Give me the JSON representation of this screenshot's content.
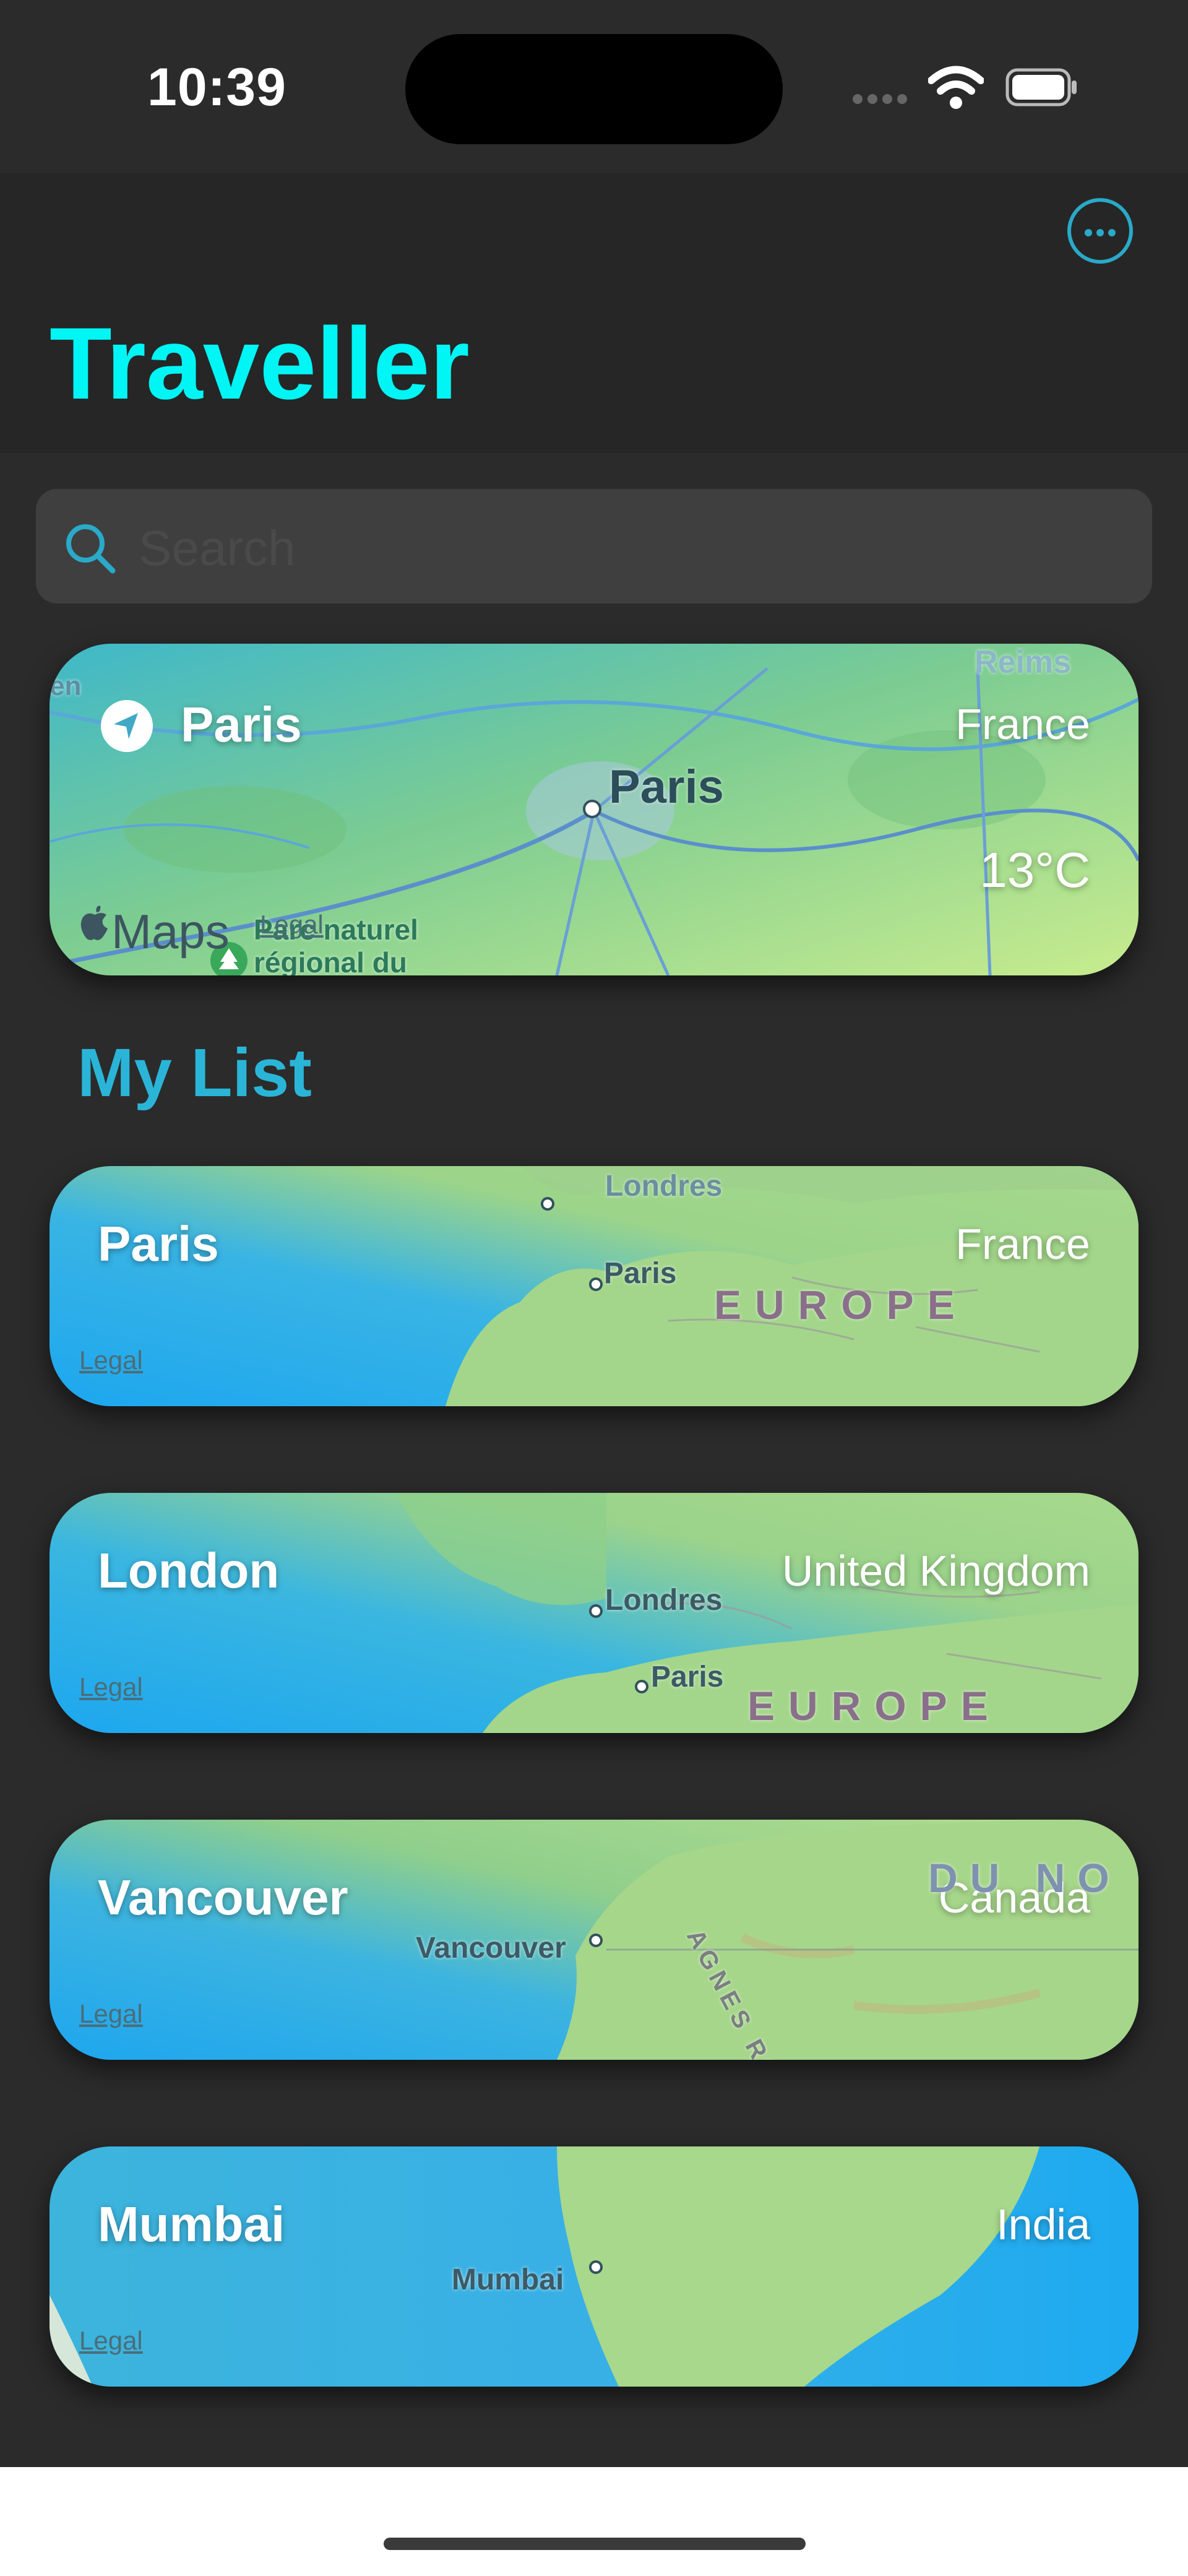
{
  "status": {
    "time": "10:39"
  },
  "app": {
    "title": "Traveller"
  },
  "search": {
    "placeholder": "Search"
  },
  "current_location": {
    "city": "Paris",
    "country": "France",
    "temperature": "13°C",
    "map_label": "Paris",
    "map_label_reims": "Reims",
    "map_label_en": "en",
    "map_park_line1": "Parc naturel",
    "map_park_line2": "régional du",
    "attribution": "Maps",
    "legal": "Legal"
  },
  "my_list": {
    "title": "My List",
    "items": [
      {
        "city": "Paris",
        "country": "France",
        "legal": "Legal",
        "labels": [
          "Londres",
          "Paris",
          "EUROPE"
        ]
      },
      {
        "city": "London",
        "country": "United Kingdom",
        "legal": "Legal",
        "labels": [
          "Londres",
          "Paris",
          "EUROPE"
        ]
      },
      {
        "city": "Vancouver",
        "country": "Canada",
        "legal": "Legal",
        "labels": [
          "Vancouver",
          "DU NO",
          "AGNES ROC"
        ]
      },
      {
        "city": "Mumbai",
        "country": "India",
        "legal": "Legal",
        "labels": [
          "Mumbai"
        ]
      }
    ]
  },
  "colors": {
    "accent": "#2aa9c8",
    "title": "#00f5f5",
    "background": "#2b2b2b"
  }
}
